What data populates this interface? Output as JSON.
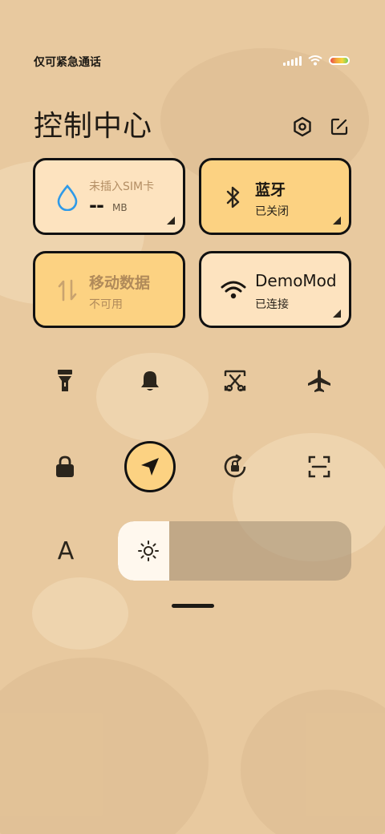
{
  "status_bar": {
    "carrier_text": "仅可紧急通话",
    "signal_icon": "signal-bars-icon",
    "wifi_icon": "wifi-icon",
    "battery_icon": "battery-icon"
  },
  "header": {
    "title": "控制中心",
    "settings_icon": "settings-hexagon-icon",
    "edit_icon": "edit-icon"
  },
  "tiles": {
    "data_usage": {
      "label": "未插入SIM卡",
      "value": "--",
      "unit": "MB",
      "icon": "water-drop-icon"
    },
    "bluetooth": {
      "title": "蓝牙",
      "status": "已关闭",
      "icon": "bluetooth-icon"
    },
    "mobile_data": {
      "title": "移动数据",
      "status": "不可用",
      "icon": "data-arrows-icon"
    },
    "wifi": {
      "title": "DemoMod",
      "status": "已连接",
      "icon": "wifi-icon"
    }
  },
  "quick_toggles": [
    {
      "name": "flashlight",
      "icon": "flashlight-icon"
    },
    {
      "name": "mute",
      "icon": "bell-icon"
    },
    {
      "name": "screenshot",
      "icon": "scissors-screenshot-icon"
    },
    {
      "name": "airplane-mode",
      "icon": "airplane-icon"
    },
    {
      "name": "lock-screen",
      "icon": "lock-icon"
    },
    {
      "name": "location",
      "icon": "location-arrow-icon",
      "active": true
    },
    {
      "name": "rotation-lock",
      "icon": "rotation-lock-icon"
    },
    {
      "name": "scan",
      "icon": "scan-icon"
    }
  ],
  "brightness": {
    "font_button": "A",
    "icon": "sun-icon",
    "level": 0.22
  },
  "colors": {
    "background": "#e8c99f",
    "tile_light": "#fde3bf",
    "tile_accent": "#fcd282",
    "border": "#111111"
  }
}
